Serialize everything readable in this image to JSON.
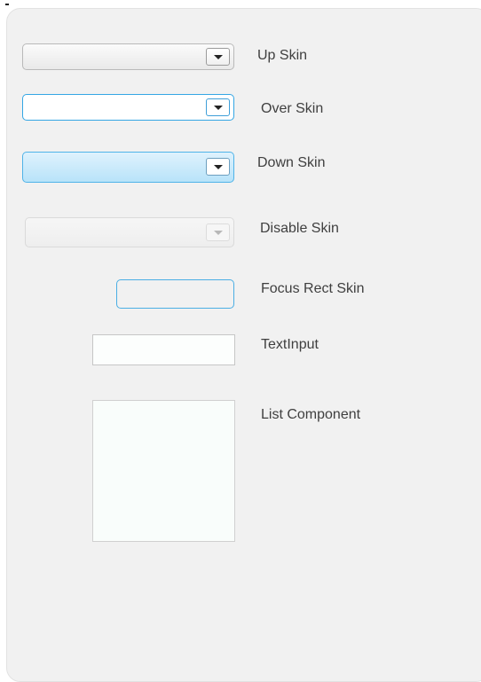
{
  "skins": {
    "up_label": "Up Skin",
    "over_label": "Over Skin",
    "down_label": "Down Skin",
    "disable_label": "Disable Skin",
    "focus_rect_label": "Focus Rect Skin",
    "text_input_label": "TextInput",
    "list_component_label": "List Component"
  },
  "colors": {
    "accent": "#34a6e4",
    "down_fill": "#b8e3f9",
    "panel_bg": "#f1f1f1"
  },
  "icons": {
    "dropdown_arrow": "chevron-down-icon"
  }
}
